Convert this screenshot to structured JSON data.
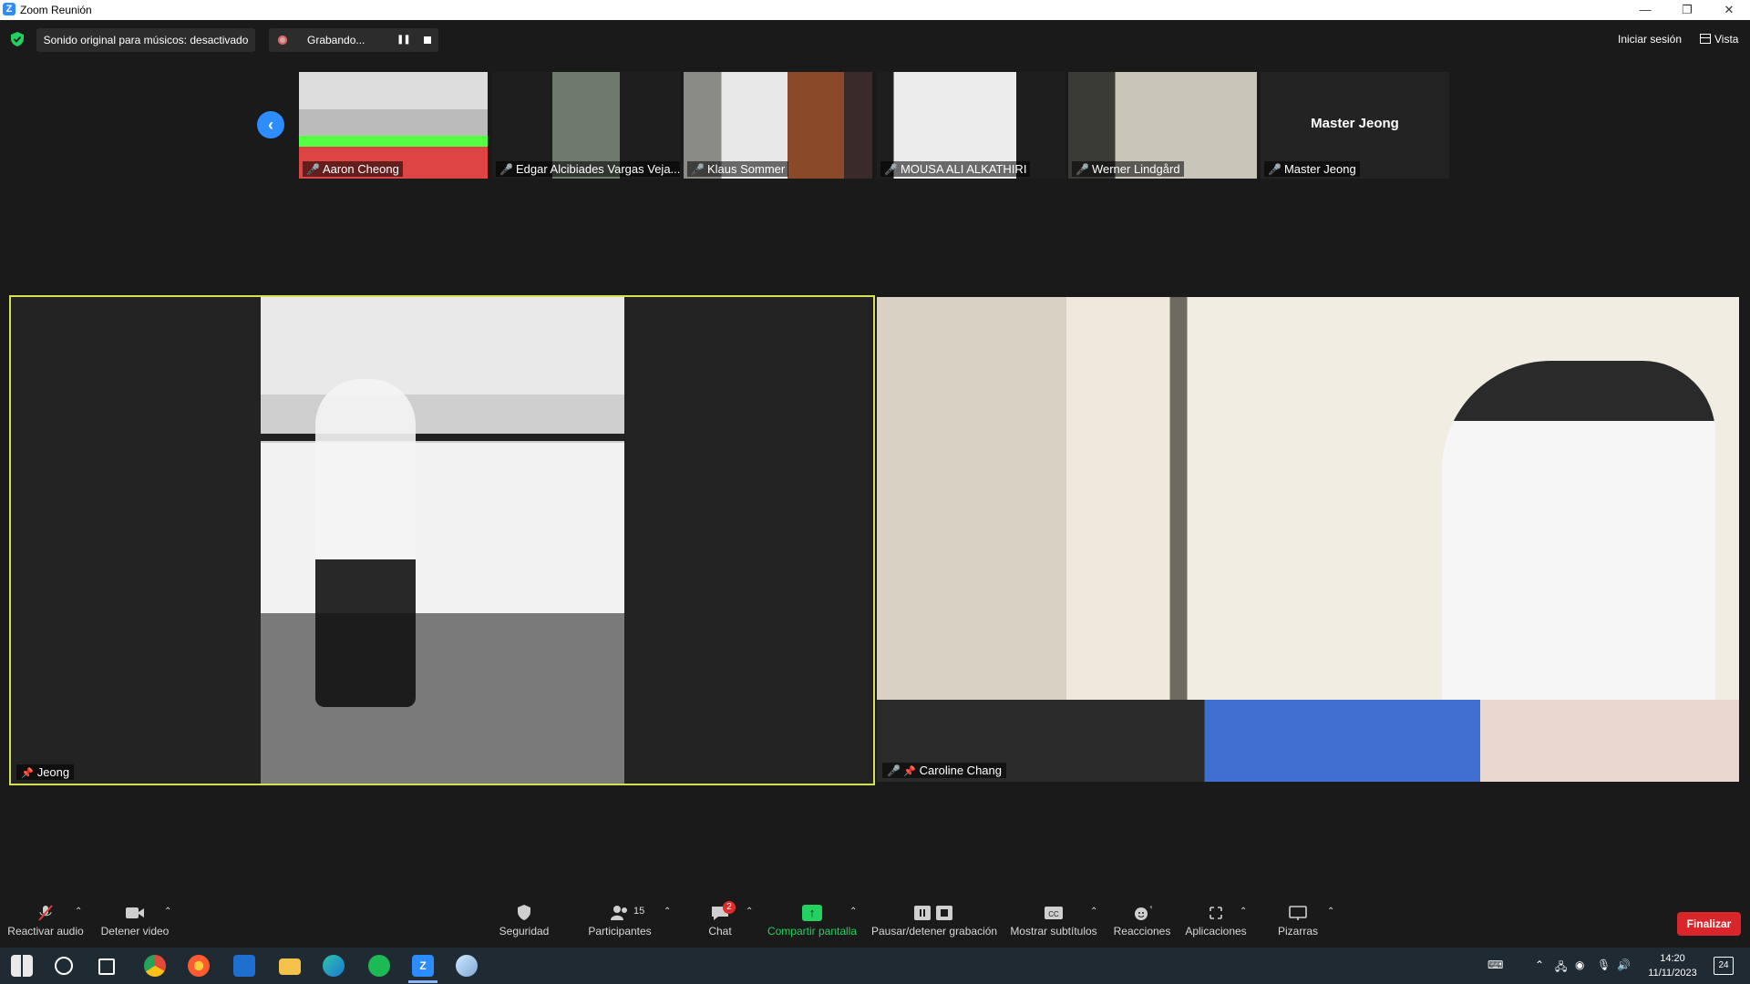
{
  "window": {
    "title": "Zoom Reunión"
  },
  "top_bar": {
    "original_sound": "Sonido original para músicos: desactivado",
    "recording_label": "Grabando...",
    "sign_in": "Iniciar sesión",
    "view": "Vista"
  },
  "thumbnails": [
    {
      "name": "Aaron Cheong",
      "muted": true
    },
    {
      "name": "Edgar Alcibiades Vargas Veja...",
      "muted": true
    },
    {
      "name": "Klaus Sommer",
      "muted": true
    },
    {
      "name": "MOUSA ALI ALKATHIRI",
      "muted": true
    },
    {
      "name": "Werner Lindgård",
      "muted": true
    },
    {
      "name": "Master Jeong",
      "muted": true,
      "video_off": true,
      "center_label": "Master Jeong"
    }
  ],
  "main_tiles": [
    {
      "name": "Jeong",
      "pinned": true,
      "active_speaker": true
    },
    {
      "name": "Caroline Chang",
      "muted": true,
      "pinned": true
    }
  ],
  "toolbar": {
    "unmute": "Reactivar audio",
    "stop_video": "Detener video",
    "security": "Seguridad",
    "participants": "Participantes",
    "participants_count": "15",
    "chat": "Chat",
    "chat_badge": "2",
    "share_screen": "Compartir pantalla",
    "pause_recording": "Pausar/detener grabación",
    "subtitles": "Mostrar subtítulos",
    "reactions": "Reacciones",
    "apps": "Aplicaciones",
    "whiteboards": "Pizarras",
    "end": "Finalizar"
  },
  "taskbar": {
    "time": "14:20",
    "date": "11/11/2023",
    "notifications": "24"
  },
  "colors": {
    "accent": "#2d8cff",
    "active_speaker_border": "#d4e157",
    "share_green": "#23d160",
    "end_red": "#d9262b",
    "muted_red": "#e03a3a"
  }
}
